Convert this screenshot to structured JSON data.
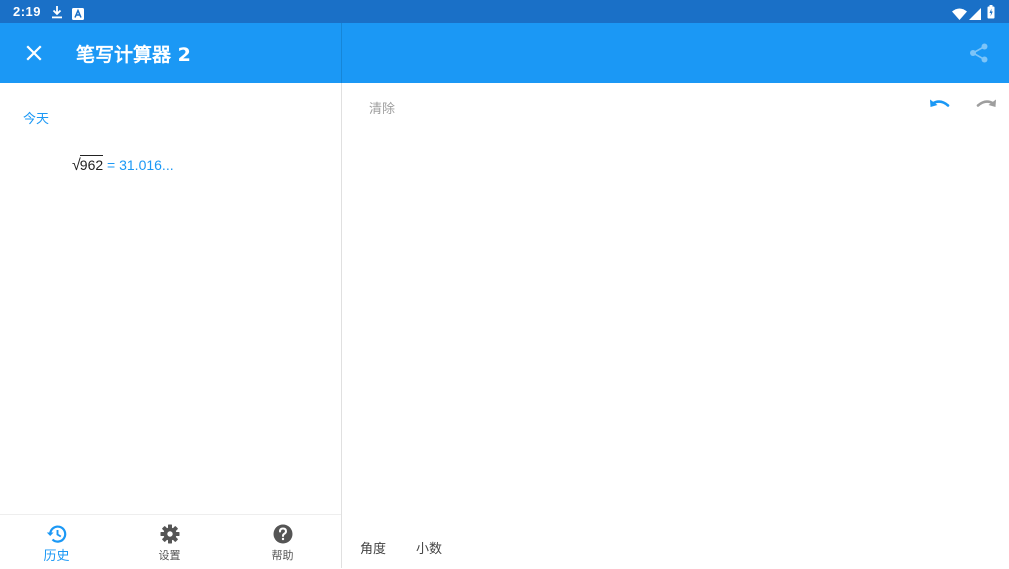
{
  "status_bar": {
    "time": "2:19",
    "icons": [
      "download-icon",
      "a-badge-icon",
      "wifi-icon",
      "cell-signal-icon",
      "battery-icon"
    ]
  },
  "app_bar": {
    "title": "笔写计算器 2",
    "close_icon": "close-icon",
    "share_icon": "share-icon",
    "color": "#1b98f5"
  },
  "history": {
    "section_label": "今天",
    "entries": [
      {
        "radicand": "962",
        "equals": "=",
        "result": "31.016..."
      }
    ]
  },
  "bottom_nav": {
    "items": [
      {
        "label": "历史",
        "icon": "history-icon",
        "active": true
      },
      {
        "label": "设置",
        "icon": "gear-icon",
        "active": false
      },
      {
        "label": "帮助",
        "icon": "help-icon",
        "active": false
      }
    ]
  },
  "editor": {
    "clear_label": "清除",
    "undo_icon": "undo-icon",
    "redo_icon": "redo-icon",
    "mode_angle_label": "角度",
    "mode_decimal_label": "小数"
  },
  "colors": {
    "accent": "#1b98f5",
    "status_bar": "#1a70c7"
  }
}
